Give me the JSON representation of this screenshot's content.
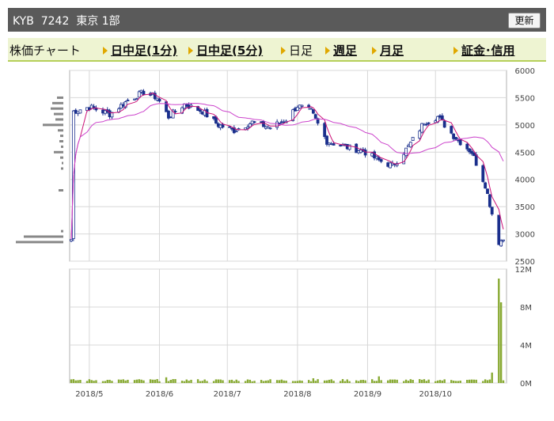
{
  "header": {
    "title": "KYB  7242  東京 1部",
    "refresh_label": "更新"
  },
  "tabs": [
    {
      "label": "株価チャート",
      "link": false,
      "arrow": false
    },
    {
      "label": "日中足(1分)",
      "link": true,
      "arrow": true
    },
    {
      "label": "日中足(5分)",
      "link": true,
      "arrow": true
    },
    {
      "label": "日足",
      "link": false,
      "arrow": true
    },
    {
      "label": "週足",
      "link": true,
      "arrow": true
    },
    {
      "label": "月足",
      "link": true,
      "arrow": true
    },
    {
      "label": "証金･信用",
      "link": true,
      "arrow": true
    }
  ],
  "colors": {
    "up": "#ffffff",
    "down": "#1a2f8c",
    "wick": "#1a2f8c",
    "ma_short": "#cc1177",
    "ma_long": "#cc44cc",
    "volume": "#88aa33",
    "grid": "#d8d8d8",
    "frame": "#b0b0b0"
  },
  "chart_data": [
    {
      "type": "candlestick",
      "title": "",
      "date_range": [
        "2018-04-23",
        "2018-10-31"
      ],
      "y_ticks": [
        2500,
        3000,
        3500,
        4000,
        4500,
        5000,
        5500,
        6000
      ],
      "ylim": [
        2500,
        6000
      ],
      "x_ticks": [
        "2018/5",
        "2018/6",
        "2018/7",
        "2018/8",
        "2018/9",
        "2018/10"
      ],
      "grid": true,
      "close_points": [
        {
          "date": "2018-04-24",
          "close": 5250
        },
        {
          "date": "2018-05-01",
          "close": 5330
        },
        {
          "date": "2018-05-10",
          "close": 5200
        },
        {
          "date": "2018-05-18",
          "close": 5450
        },
        {
          "date": "2018-05-25",
          "close": 5600
        },
        {
          "date": "2018-05-31",
          "close": 5500
        },
        {
          "date": "2018-06-05",
          "close": 5150
        },
        {
          "date": "2018-06-12",
          "close": 5380
        },
        {
          "date": "2018-06-20",
          "close": 5250
        },
        {
          "date": "2018-06-27",
          "close": 5000
        },
        {
          "date": "2018-07-04",
          "close": 4900
        },
        {
          "date": "2018-07-12",
          "close": 5050
        },
        {
          "date": "2018-07-20",
          "close": 4950
        },
        {
          "date": "2018-07-27",
          "close": 5100
        },
        {
          "date": "2018-08-01",
          "close": 5350
        },
        {
          "date": "2018-08-07",
          "close": 5250
        },
        {
          "date": "2018-08-14",
          "close": 4700
        },
        {
          "date": "2018-08-22",
          "close": 4600
        },
        {
          "date": "2018-08-30",
          "close": 4520
        },
        {
          "date": "2018-09-06",
          "close": 4350
        },
        {
          "date": "2018-09-12",
          "close": 4250
        },
        {
          "date": "2018-09-19",
          "close": 4600
        },
        {
          "date": "2018-09-26",
          "close": 5050
        },
        {
          "date": "2018-10-02",
          "close": 5150
        },
        {
          "date": "2018-10-09",
          "close": 4800
        },
        {
          "date": "2018-10-17",
          "close": 4500
        },
        {
          "date": "2018-10-23",
          "close": 3900
        },
        {
          "date": "2018-10-29",
          "close": 2850
        },
        {
          "date": "2018-10-31",
          "close": 2900
        }
      ],
      "volume_profile": [
        {
          "price": 5500,
          "volume": 8
        },
        {
          "price": 5400,
          "volume": 14
        },
        {
          "price": 5300,
          "volume": 16
        },
        {
          "price": 5200,
          "volume": 12
        },
        {
          "price": 5100,
          "volume": 10
        },
        {
          "price": 5000,
          "volume": 26
        },
        {
          "price": 4900,
          "volume": 7
        },
        {
          "price": 4800,
          "volume": 4
        },
        {
          "price": 4700,
          "volume": 5
        },
        {
          "price": 4600,
          "volume": 3
        },
        {
          "price": 4500,
          "volume": 12
        },
        {
          "price": 4400,
          "volume": 4
        },
        {
          "price": 4300,
          "volume": 2
        },
        {
          "price": 4200,
          "volume": 3
        },
        {
          "price": 3800,
          "volume": 6
        },
        {
          "price": 3050,
          "volume": 3
        },
        {
          "price": 2950,
          "volume": 50
        },
        {
          "price": 2850,
          "volume": 60
        }
      ]
    },
    {
      "type": "bar",
      "title": "",
      "y_ticks": [
        "0M",
        "4M",
        "8M",
        "12M"
      ],
      "ylim": [
        0,
        12
      ],
      "baseline_volume_m": 0.3,
      "spikes_m": [
        {
          "date": "2018-06-04",
          "volume": 0.6
        },
        {
          "date": "2018-08-08",
          "volume": 0.5
        },
        {
          "date": "2018-09-06",
          "volume": 0.7
        },
        {
          "date": "2018-10-26",
          "volume": 1.1
        },
        {
          "date": "2018-10-29",
          "volume": 11.0
        },
        {
          "date": "2018-10-30",
          "volume": 8.5
        }
      ]
    }
  ]
}
